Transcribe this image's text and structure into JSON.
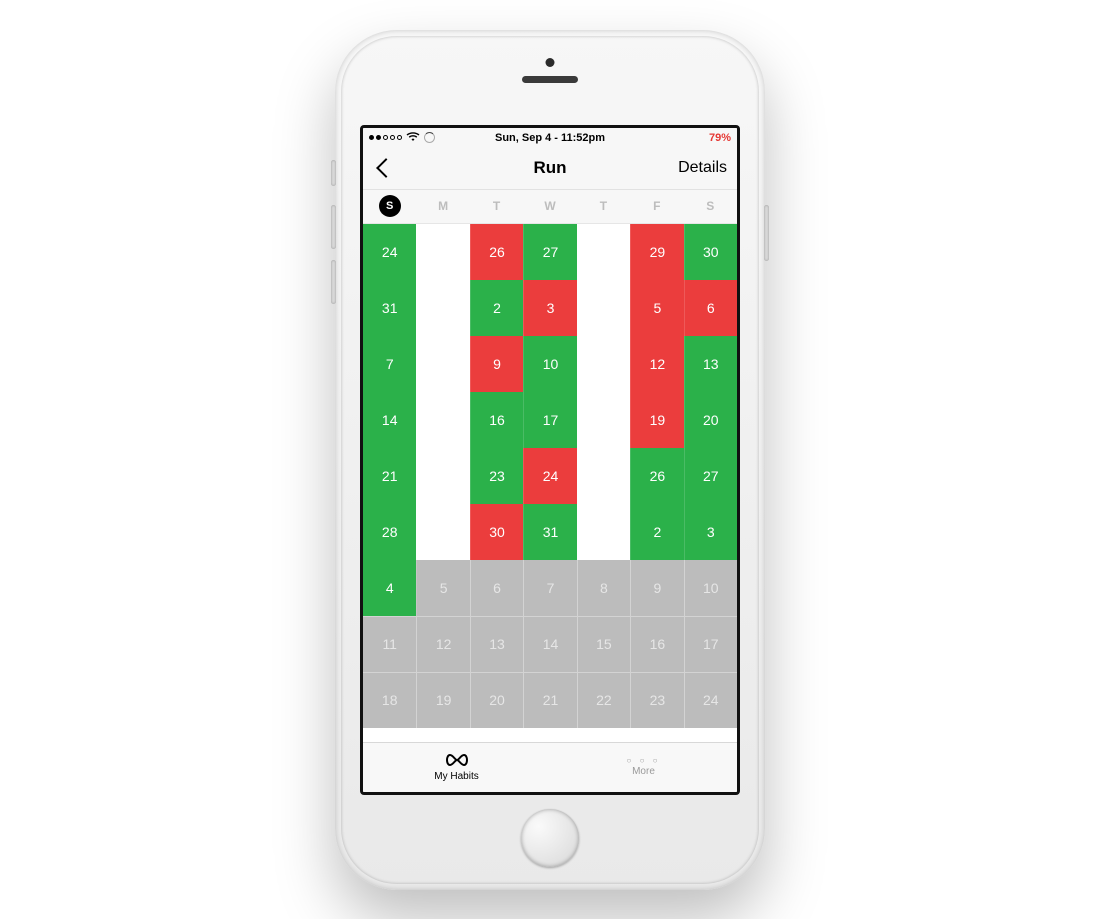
{
  "statusbar": {
    "signal_filled": 2,
    "signal_total": 5,
    "datetime": "Sun, Sep 4 - 11:52pm",
    "battery_pct": "79%",
    "battery_color": "#e53935"
  },
  "nav": {
    "title": "Run",
    "right_label": "Details"
  },
  "days_of_week": [
    "S",
    "M",
    "T",
    "W",
    "T",
    "F",
    "S"
  ],
  "today_dow_index": 0,
  "calendar_rows": [
    [
      {
        "n": 24,
        "s": "green"
      },
      {
        "n": "",
        "s": "white"
      },
      {
        "n": 26,
        "s": "red"
      },
      {
        "n": 27,
        "s": "green"
      },
      {
        "n": "",
        "s": "white"
      },
      {
        "n": 29,
        "s": "red"
      },
      {
        "n": 30,
        "s": "green"
      }
    ],
    [
      {
        "n": 31,
        "s": "green"
      },
      {
        "n": "",
        "s": "white"
      },
      {
        "n": 2,
        "s": "green"
      },
      {
        "n": 3,
        "s": "red"
      },
      {
        "n": "",
        "s": "white"
      },
      {
        "n": 5,
        "s": "red"
      },
      {
        "n": 6,
        "s": "red"
      }
    ],
    [
      {
        "n": 7,
        "s": "green"
      },
      {
        "n": "",
        "s": "white"
      },
      {
        "n": 9,
        "s": "red"
      },
      {
        "n": 10,
        "s": "green"
      },
      {
        "n": "",
        "s": "white"
      },
      {
        "n": 12,
        "s": "red"
      },
      {
        "n": 13,
        "s": "green"
      }
    ],
    [
      {
        "n": 14,
        "s": "green"
      },
      {
        "n": "",
        "s": "white"
      },
      {
        "n": 16,
        "s": "green"
      },
      {
        "n": 17,
        "s": "green"
      },
      {
        "n": "",
        "s": "white"
      },
      {
        "n": 19,
        "s": "red"
      },
      {
        "n": 20,
        "s": "green"
      }
    ],
    [
      {
        "n": 21,
        "s": "green"
      },
      {
        "n": "",
        "s": "white"
      },
      {
        "n": 23,
        "s": "green"
      },
      {
        "n": 24,
        "s": "red"
      },
      {
        "n": "",
        "s": "white"
      },
      {
        "n": 26,
        "s": "green"
      },
      {
        "n": 27,
        "s": "green"
      }
    ],
    [
      {
        "n": 28,
        "s": "green"
      },
      {
        "n": "",
        "s": "white"
      },
      {
        "n": 30,
        "s": "red"
      },
      {
        "n": 31,
        "s": "green"
      },
      {
        "n": "",
        "s": "white"
      },
      {
        "n": 2,
        "s": "green"
      },
      {
        "n": 3,
        "s": "green"
      }
    ],
    [
      {
        "n": 4,
        "s": "green"
      },
      {
        "n": 5,
        "s": "grey"
      },
      {
        "n": 6,
        "s": "grey"
      },
      {
        "n": 7,
        "s": "grey"
      },
      {
        "n": 8,
        "s": "grey"
      },
      {
        "n": 9,
        "s": "grey"
      },
      {
        "n": 10,
        "s": "grey"
      }
    ],
    [
      {
        "n": 11,
        "s": "grey"
      },
      {
        "n": 12,
        "s": "grey"
      },
      {
        "n": 13,
        "s": "grey"
      },
      {
        "n": 14,
        "s": "grey"
      },
      {
        "n": 15,
        "s": "grey"
      },
      {
        "n": 16,
        "s": "grey"
      },
      {
        "n": 17,
        "s": "grey"
      }
    ],
    [
      {
        "n": 18,
        "s": "grey"
      },
      {
        "n": 19,
        "s": "grey"
      },
      {
        "n": 20,
        "s": "grey"
      },
      {
        "n": 21,
        "s": "grey"
      },
      {
        "n": 22,
        "s": "grey"
      },
      {
        "n": 23,
        "s": "grey"
      },
      {
        "n": 24,
        "s": "grey"
      }
    ]
  ],
  "tabs": {
    "habits_label": "My Habits",
    "more_label": "More"
  },
  "colors": {
    "green": "#2bb14a",
    "red": "#eb3d3d",
    "grey": "#bcbcbc"
  }
}
